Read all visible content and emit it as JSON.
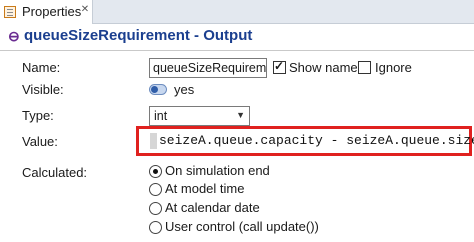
{
  "tab": {
    "label": "Properties",
    "close": "✕"
  },
  "header": {
    "title": "queueSizeRequirement - Output"
  },
  "name": {
    "label": "Name:",
    "value": "queueSizeRequireme",
    "show_name_label": "Show name",
    "show_name_checked": true,
    "ignore_label": "Ignore",
    "ignore_checked": false
  },
  "visible": {
    "label": "Visible:",
    "value": "yes"
  },
  "type": {
    "label": "Type:",
    "value": "int"
  },
  "value": {
    "label": "Value:",
    "expression": "seizeA.queue.capacity - seizeA.queue.size()"
  },
  "calculated": {
    "label": "Calculated:",
    "options": [
      {
        "label": "On simulation end",
        "selected": true
      },
      {
        "label": "At model time",
        "selected": false
      },
      {
        "label": "At calendar date",
        "selected": false
      },
      {
        "label": "User control (call update())",
        "selected": false
      }
    ]
  },
  "colors": {
    "highlight_border": "#e0211f",
    "title": "#1b3f8f"
  }
}
